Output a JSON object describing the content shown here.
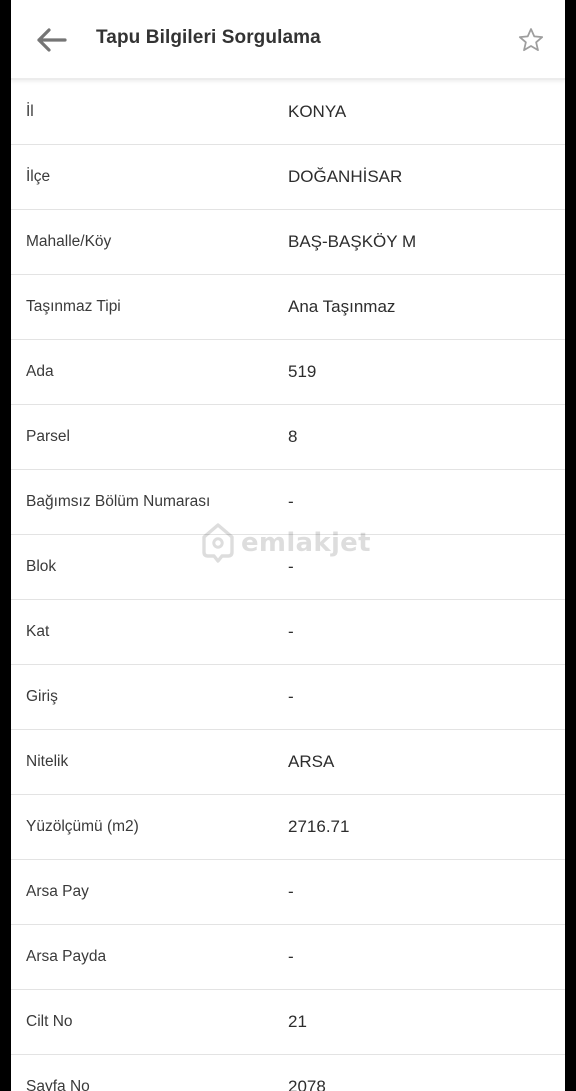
{
  "header": {
    "title": "Tapu Bilgileri Sorgulama",
    "back_icon": "arrow-left-icon",
    "favorite_icon": "star-outline-icon"
  },
  "rows": [
    {
      "label": "İl",
      "value": "KONYA"
    },
    {
      "label": "İlçe",
      "value": "DOĞANHİSAR"
    },
    {
      "label": "Mahalle/Köy",
      "value": "BAŞ-BAŞKÖY M"
    },
    {
      "label": "Taşınmaz Tipi",
      "value": "Ana Taşınmaz"
    },
    {
      "label": "Ada",
      "value": "519"
    },
    {
      "label": "Parsel",
      "value": "8"
    },
    {
      "label": "Bağımsız Bölüm Numarası",
      "value": "-"
    },
    {
      "label": "Blok",
      "value": "-"
    },
    {
      "label": "Kat",
      "value": "-"
    },
    {
      "label": "Giriş",
      "value": "-"
    },
    {
      "label": "Nitelik",
      "value": "ARSA"
    },
    {
      "label": "Yüzölçümü (m2)",
      "value": "2716.71"
    },
    {
      "label": "Arsa Pay",
      "value": "-"
    },
    {
      "label": "Arsa Payda",
      "value": "-"
    },
    {
      "label": "Cilt No",
      "value": "21"
    },
    {
      "label": "Sayfa No",
      "value": "2078"
    }
  ],
  "watermark": {
    "text": "emlakjet",
    "icon": "home-pin-icon"
  },
  "colors": {
    "text_primary": "#333333",
    "divider": "#e3e3e3",
    "background": "#ffffff"
  }
}
